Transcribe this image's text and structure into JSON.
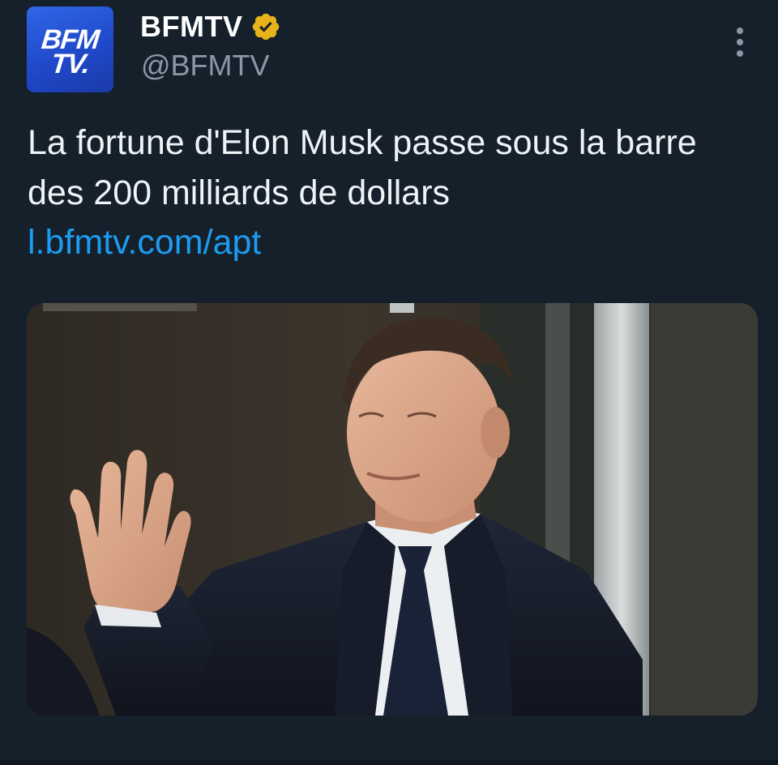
{
  "author": {
    "display_name": "BFMTV",
    "handle": "@BFMTV",
    "avatar_text_line1": "BFM",
    "avatar_text_line2": "TV.",
    "verified_icon": "verified-badge-gold",
    "verified_color": "#e8b31a"
  },
  "tweet": {
    "text": "La fortune d'Elon Musk passe sous la barre des 200 milliards de dollars",
    "link": "l.bfmtv.com/apt"
  },
  "media": {
    "kind": "photo"
  },
  "icons": {
    "more": "more-vertical-icon"
  },
  "colors": {
    "background": "#15202b",
    "text": "#eef3f7",
    "secondary_text": "#8b98a5",
    "link": "#1d9bf0",
    "avatar_blue": "#2f66e8"
  }
}
